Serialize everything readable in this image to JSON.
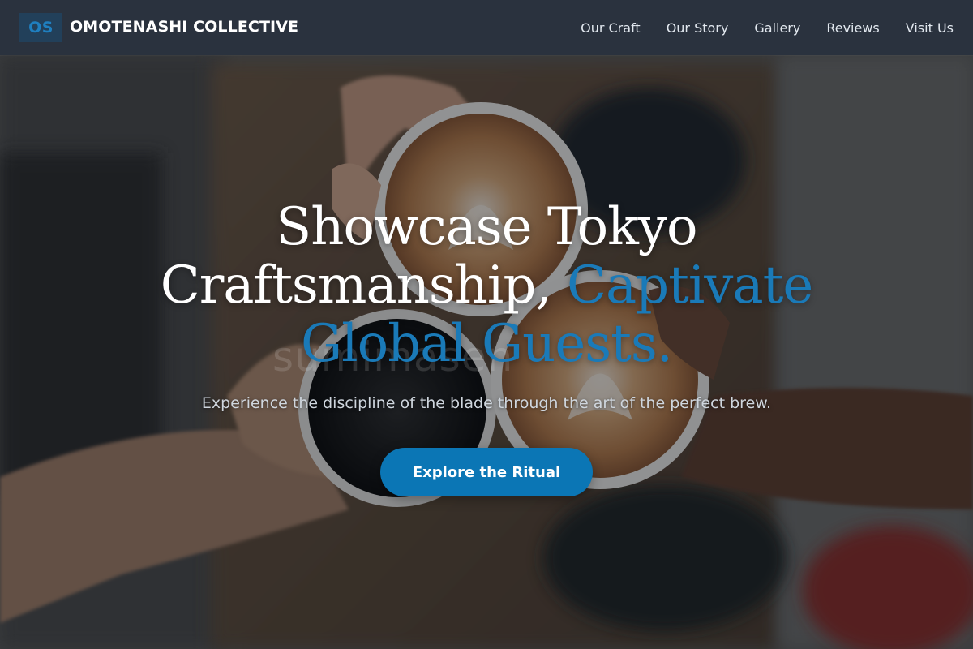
{
  "header": {
    "logo_text": "OS",
    "brand": "OMOTENASHI COLLECTIVE",
    "nav": [
      {
        "label": "Our Craft"
      },
      {
        "label": "Our Story"
      },
      {
        "label": "Gallery"
      },
      {
        "label": "Reviews"
      },
      {
        "label": "Visit Us"
      }
    ]
  },
  "hero": {
    "title_line_1": "Showcase Tokyo",
    "title_line_2_plain": "Craftsmanship, ",
    "title_line_2_accent": "Captivate",
    "title_line_3_accent": "Global Guests.",
    "watermark": "sumimasen",
    "subtitle": "Experience the discipline of the blade through the art of the perfect brew.",
    "cta_label": "Explore the Ritual"
  },
  "colors": {
    "header_bg": "#2a323e",
    "accent": "#0b76b5",
    "logo_badge_bg": "#22405a",
    "text_primary": "#ffffff"
  },
  "icons": [
    "latte-cups-photo"
  ]
}
